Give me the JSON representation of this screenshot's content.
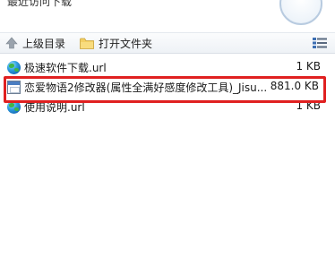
{
  "header": {
    "partial_text": "最近访问下载"
  },
  "toolbar": {
    "up_label": "上级目录",
    "open_folder_label": "打开文件夹",
    "view_icon": "view-details-icon"
  },
  "files": [
    {
      "name": "极速软件下载.url",
      "size": "1 KB",
      "icon": "internet-shortcut-icon"
    },
    {
      "name": "恋爱物语2修改器(属性全满好感度修改工具)_Jisu...",
      "size": "881.0 KB",
      "icon": "executable-icon",
      "highlighted": true
    },
    {
      "name": "使用说明.url",
      "size": "1 KB",
      "icon": "internet-shortcut-icon"
    }
  ],
  "colors": {
    "highlight_border": "#e02020",
    "toolbar_bg": "#eef2f6"
  }
}
